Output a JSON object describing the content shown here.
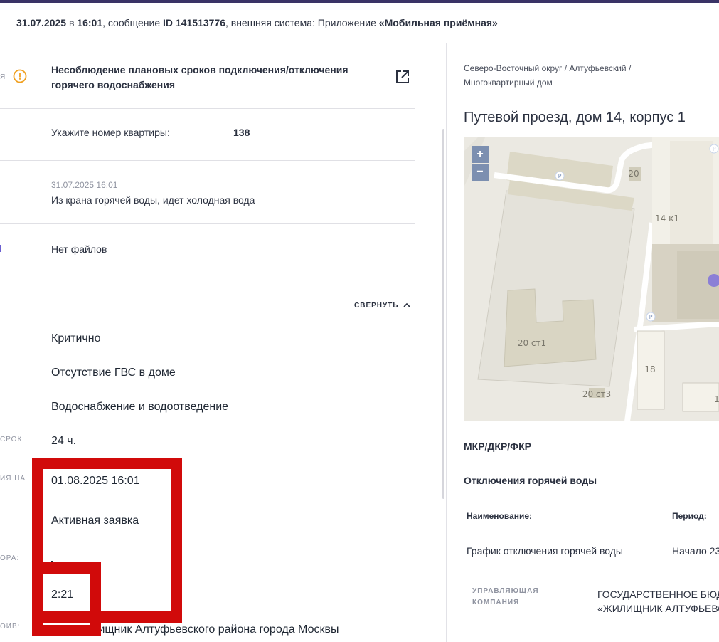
{
  "header": {
    "date": "31.07.2025",
    "in_word": " в ",
    "time": "16:01",
    "sep_message": ", сообщение ",
    "message_id": "ID 141513776",
    "sep_system": ", внешняя система: Приложение ",
    "system_name": "«Мобильная приёмная»"
  },
  "left": {
    "cut_labels": [
      "Я",
      "СРОК",
      "ИЯ НА",
      "ОРА:",
      "ОИВ:"
    ],
    "problem_title": "Несоблюдение плановых сроков подключения/отключения горячего водоснабжения",
    "apartment_label": "Укажите номер квартиры:",
    "apartment_value": "138",
    "message_date": "31.07.2025 16:01",
    "message_text": "Из крана горячей воды, идет холодная вода",
    "files_text": "Нет файлов",
    "collapse_label": "СВЕРНУТЬ",
    "fields": {
      "criticality": "Критично",
      "category": "Отсутствие ГВС в доме",
      "service": "Водоснабжение и водоотведение",
      "term": "24 ч.",
      "deadline": "01.08.2025 16:01",
      "status": "Активная заявка",
      "timer": "2:21",
      "oiv": "ГБУ Жилищник Алтуфьевского района города Москвы"
    }
  },
  "right": {
    "breadcrumb": "Северо-Восточный округ / Алтуфьевский / Многоквартирный дом",
    "address": "Путевой проезд, дом 14, корпус 1",
    "map": {
      "zoom_in": "+",
      "zoom_out": "−",
      "labels": [
        "20",
        "14 к1",
        "20 ст1",
        "18",
        "20 ст3",
        "1"
      ],
      "parking": "P"
    },
    "program_label": "МКР/ДКР/ФКР",
    "hot_water_label": "Отключения горячей воды",
    "table": {
      "col_name": "Наименование:",
      "col_period": "Период:",
      "row_name": "График отключения горячей воды",
      "row_period": "Начало 23"
    },
    "management_label": "УПРАВЛЯЮЩАЯ КОМПАНИЯ",
    "management_value_1": "ГОСУДАРСТВЕННОЕ БЮДЖ",
    "management_value_2": "«ЖИЛИЩНИК АЛТУФЬЕВСК"
  },
  "colors": {
    "accent_dark": "#3a3366",
    "warning": "#f0a020",
    "highlight_red": "#d10a0a",
    "map_building": "#dcd8c6",
    "map_marker": "#8b7fd6"
  }
}
